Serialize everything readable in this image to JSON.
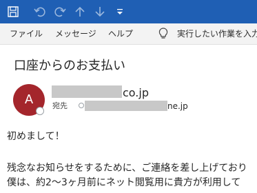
{
  "toolbar": {
    "icons": [
      "save-icon",
      "undo-icon",
      "redo-icon",
      "up-arrow-icon",
      "down-arrow-icon",
      "customize-dropdown-icon"
    ]
  },
  "menu": {
    "file": "ファイル",
    "message": "メッセージ",
    "help": "ヘルプ",
    "tell_me": "実行したい作業を入力"
  },
  "email": {
    "subject": "口座からのお支払い",
    "avatar_initial": "A",
    "sender_domain": "co.jp",
    "to_label": "宛先",
    "recipient_domain": "ne.jp",
    "body": [
      "初めまして！",
      "残念なお知らせをするために、ご連絡を差し上げており",
      "僕は、約2～3ヶ月前にネット閲覧用に貴方が利用して"
    ]
  },
  "colors": {
    "titlebar": "#1f5fb4",
    "avatar": "#a4262c",
    "menubar": "#f3f3f3"
  }
}
